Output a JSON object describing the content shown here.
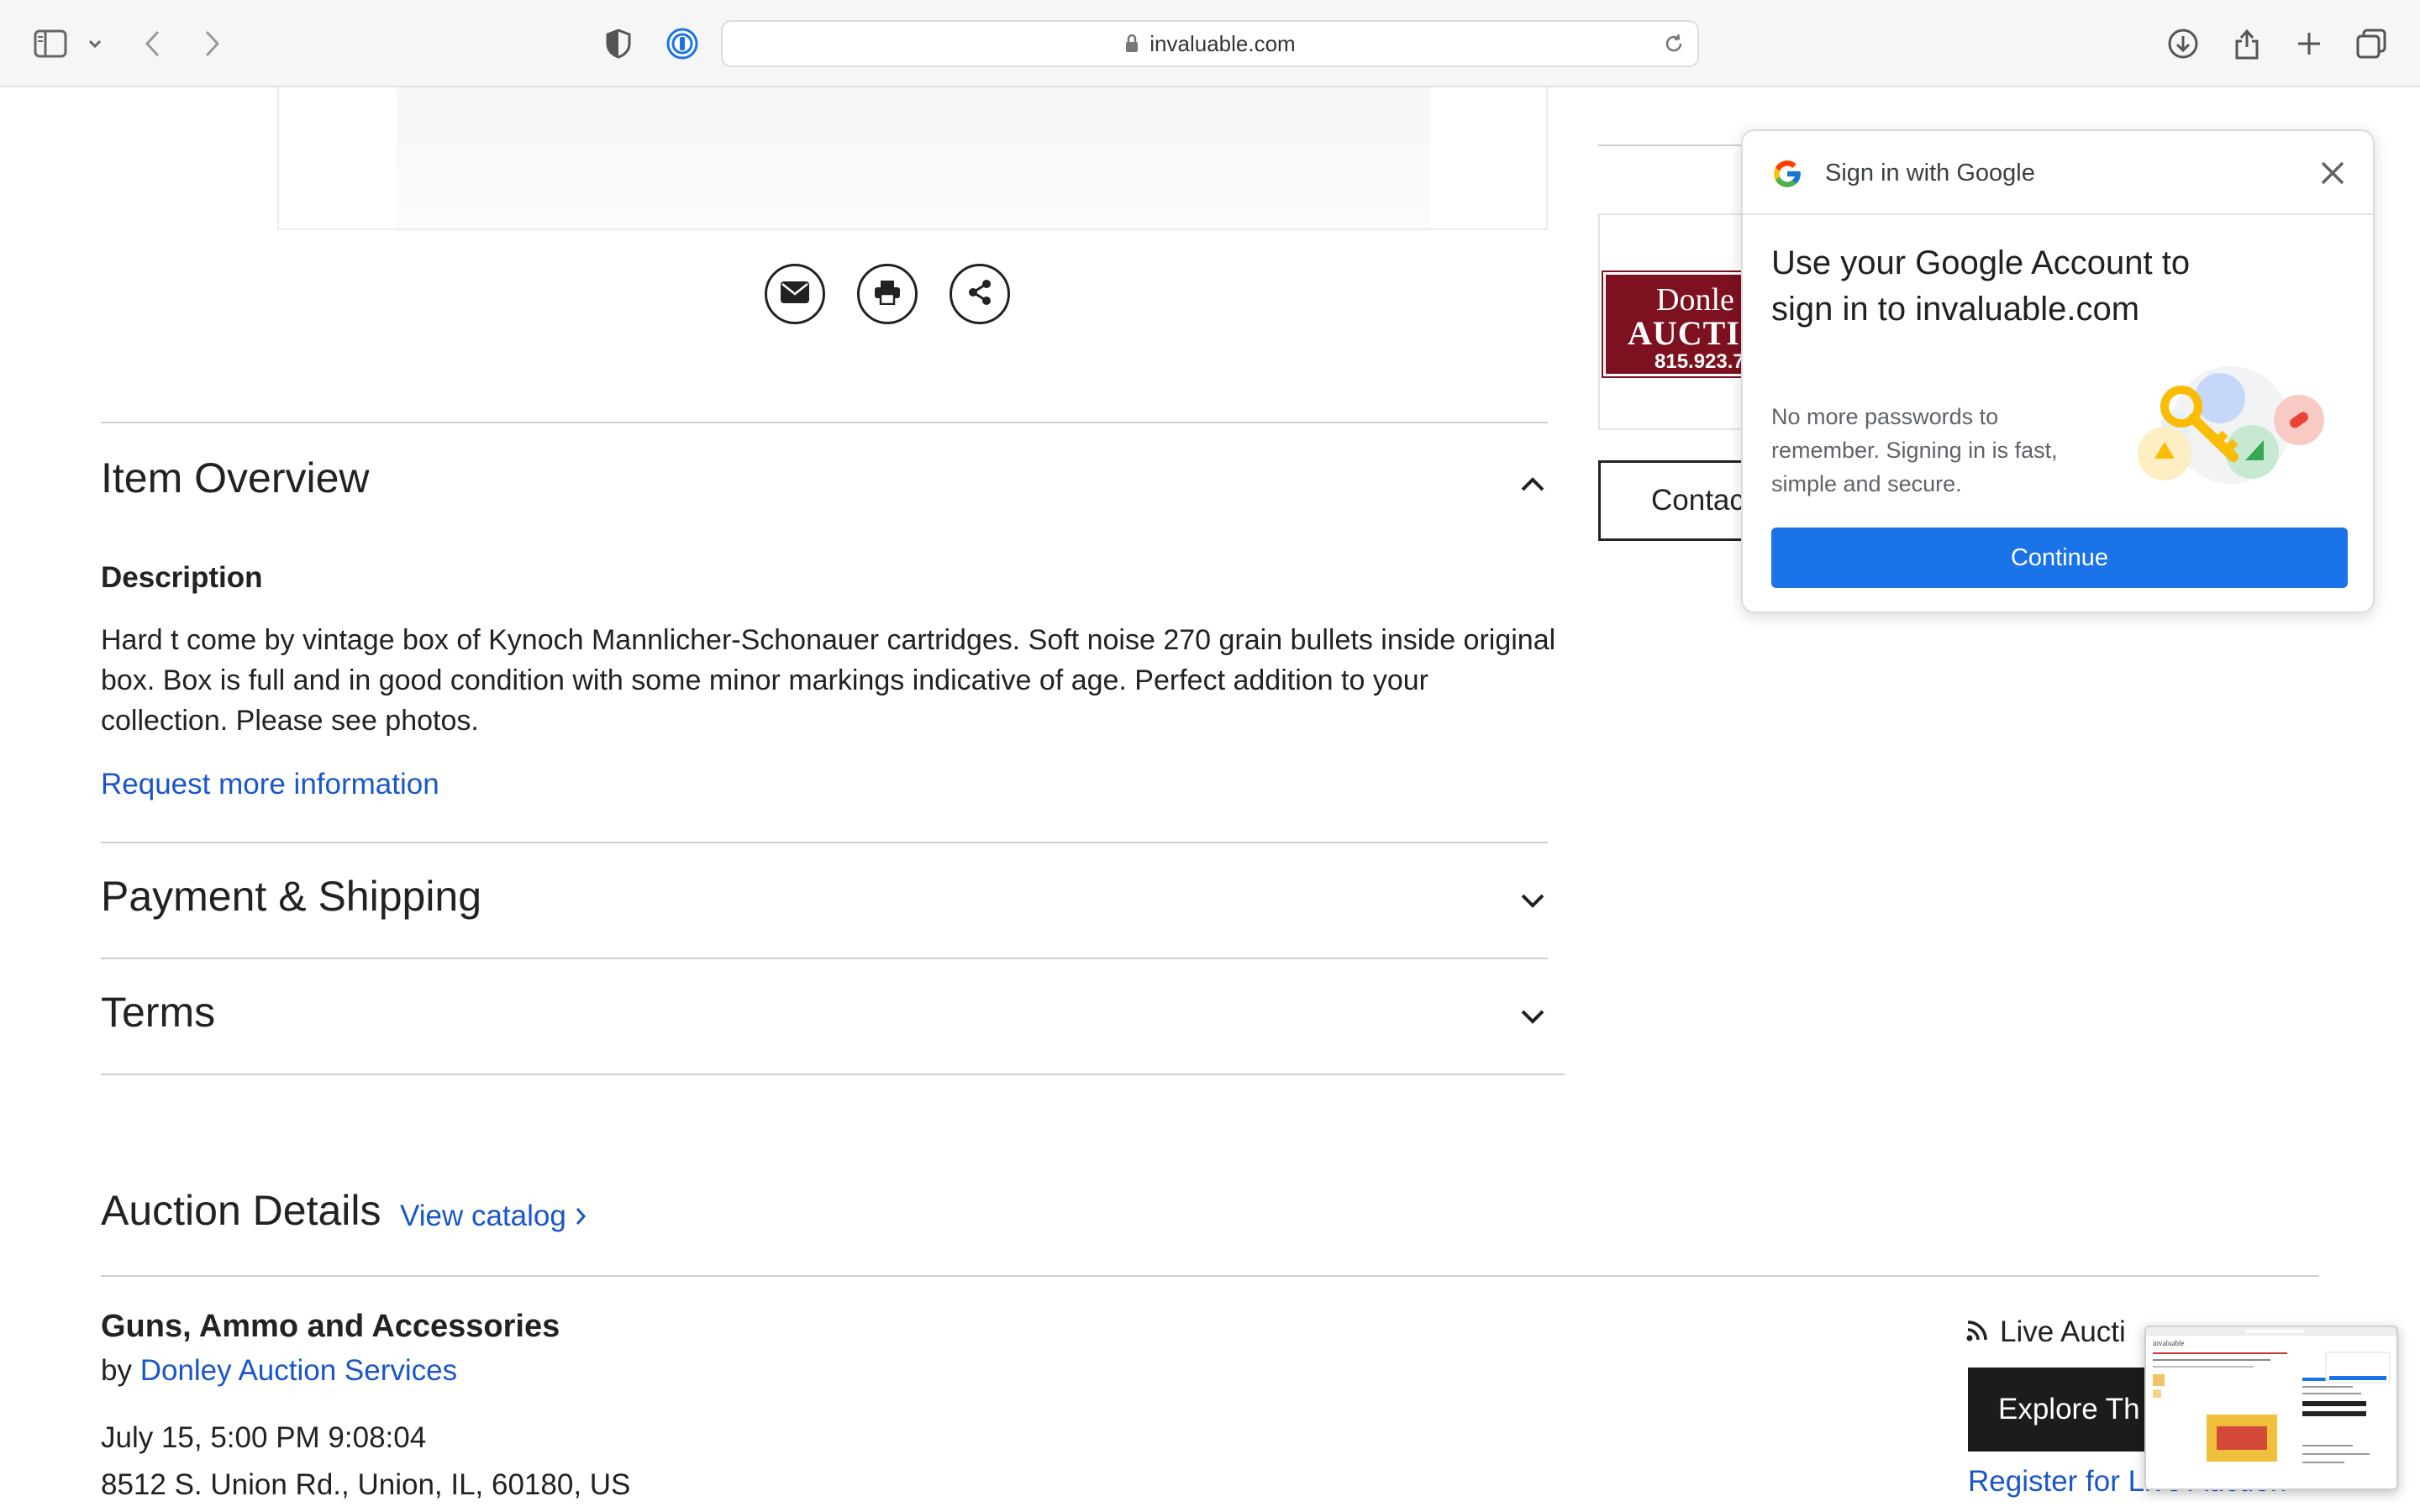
{
  "browser": {
    "url": "invaluable.com"
  },
  "item": {
    "overview_title": "Item Overview",
    "description_label": "Description",
    "description_text": "Hard t come by vintage box of Kynoch Mannlicher-Schonauer cartridges. Soft noise 270 grain bullets inside original box. Box is full and in good condition with some minor markings indicative of age. Perfect addition to your collection. Please see photos.",
    "request_info_link": "Request more information",
    "payment_title": "Payment & Shipping",
    "terms_title": "Terms"
  },
  "auction": {
    "title": "Auction Details",
    "view_catalog": "View catalog",
    "sale_name": "Guns, Ammo and Accessories",
    "by_prefix": "by",
    "auctioneer": "Donley Auction Services",
    "date": "July 15, 5:00 PM 9:08:04",
    "address": "8512 S. Union Rd., Union, IL, 60180, US",
    "live_label": "Live Aucti",
    "explore_button": "Explore Th",
    "register_link": "Register for Live Auction"
  },
  "seller": {
    "logo_line1": "Donle",
    "logo_line2": "AUCTIO",
    "logo_line3": "815.923.7",
    "contact_button": "Contac"
  },
  "google_popup": {
    "header": "Sign in with Google",
    "title": "Use your Google Account to sign in to invaluable.com",
    "subtitle": "No more passwords to remember. Signing in is fast, simple and secure.",
    "continue_button": "Continue",
    "brand_colors": [
      "#4285F4",
      "#EA4335",
      "#FBBC05",
      "#34A853"
    ]
  },
  "thumbnail": {
    "brand": "invaluable"
  },
  "colors": {
    "link": "#1a56c9",
    "google_blue": "#1a73e8",
    "seller_maroon": "#7d1120"
  }
}
